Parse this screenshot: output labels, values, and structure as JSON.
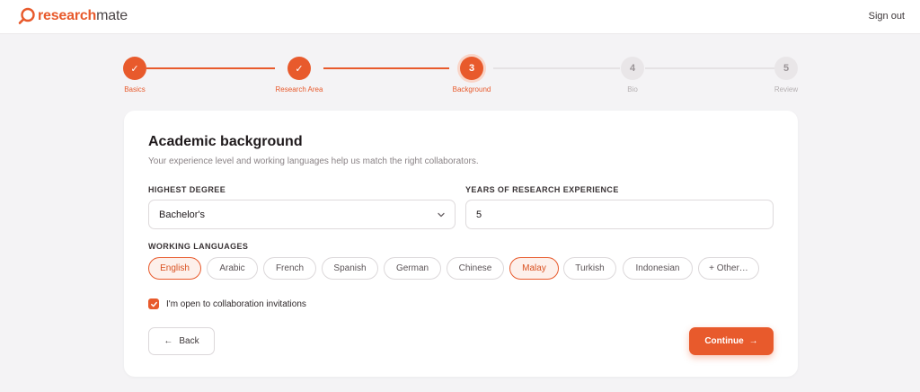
{
  "brand": {
    "part1": "research",
    "part2": "mate",
    "accent": "#e85a2c"
  },
  "header": {
    "signout": "Sign out"
  },
  "stepper": {
    "steps": [
      {
        "number": "✓",
        "label": "Basics",
        "state": "done"
      },
      {
        "number": "✓",
        "label": "Research Area",
        "state": "done"
      },
      {
        "number": "3",
        "label": "Background",
        "state": "active"
      },
      {
        "number": "4",
        "label": "Bio",
        "state": "todo"
      },
      {
        "number": "5",
        "label": "Review",
        "state": "todo"
      }
    ]
  },
  "form": {
    "title": "Academic background",
    "subtitle": "Your experience level and working languages help us match the right collaborators.",
    "degree_label": "HIGHEST DEGREE",
    "degree_value": "Bachelor's",
    "years_label": "YEARS OF RESEARCH EXPERIENCE",
    "years_value": "5",
    "languages_label": "WORKING LANGUAGES",
    "languages": [
      {
        "name": "English",
        "selected": true
      },
      {
        "name": "Arabic",
        "selected": false
      },
      {
        "name": "French",
        "selected": false
      },
      {
        "name": "Spanish",
        "selected": false
      },
      {
        "name": "German",
        "selected": false
      },
      {
        "name": "Chinese",
        "selected": false
      },
      {
        "name": "Malay",
        "selected": true
      },
      {
        "name": "Turkish",
        "selected": false
      },
      {
        "name": "Indonesian",
        "selected": false
      },
      {
        "name": "+ Other…",
        "selected": false
      }
    ],
    "collab_label": "I'm open to collaboration invitations",
    "collab_checked": true,
    "back_label": "Back",
    "continue_label": "Continue"
  }
}
